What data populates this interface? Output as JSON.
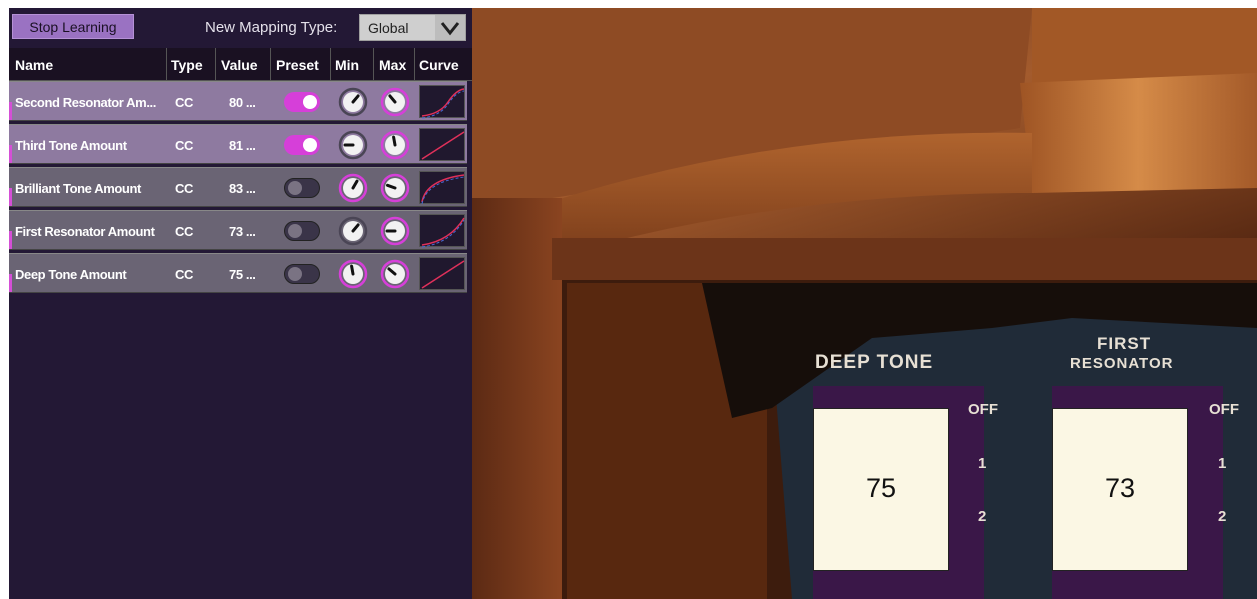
{
  "toolbar": {
    "stop_label": "Stop Learning",
    "mapping_label": "New Mapping Type:",
    "mapping_value": "Global"
  },
  "table": {
    "headers": [
      "Name",
      "Type",
      "Value",
      "Preset",
      "Min",
      "Max",
      "Curve"
    ],
    "rows": [
      {
        "name": "Second Resonator Am...",
        "type": "CC",
        "value": "80 ...",
        "preset": true
      },
      {
        "name": "Third Tone Amount",
        "type": "CC",
        "value": "81 ...",
        "preset": true
      },
      {
        "name": "Brilliant Tone Amount",
        "type": "CC",
        "value": "83 ...",
        "preset": false
      },
      {
        "name": "First Resonator Amount",
        "type": "CC",
        "value": "73 ...",
        "preset": false
      },
      {
        "name": "Deep Tone Amount",
        "type": "CC",
        "value": "75 ...",
        "preset": false
      }
    ]
  },
  "instrument": {
    "deep_tone": {
      "title": "DEEP TONE",
      "value": "75"
    },
    "first_resonator": {
      "title_1": "FIRST",
      "title_2": "RESONATOR",
      "value": "73"
    },
    "pos_off": "OFF",
    "pos_1": "1",
    "pos_2": "2"
  },
  "colors": {
    "panel_bg": "#231835",
    "accent": "#d63fd9",
    "row_selected": "#8e7aa0",
    "row_normal": "#6a6474"
  }
}
